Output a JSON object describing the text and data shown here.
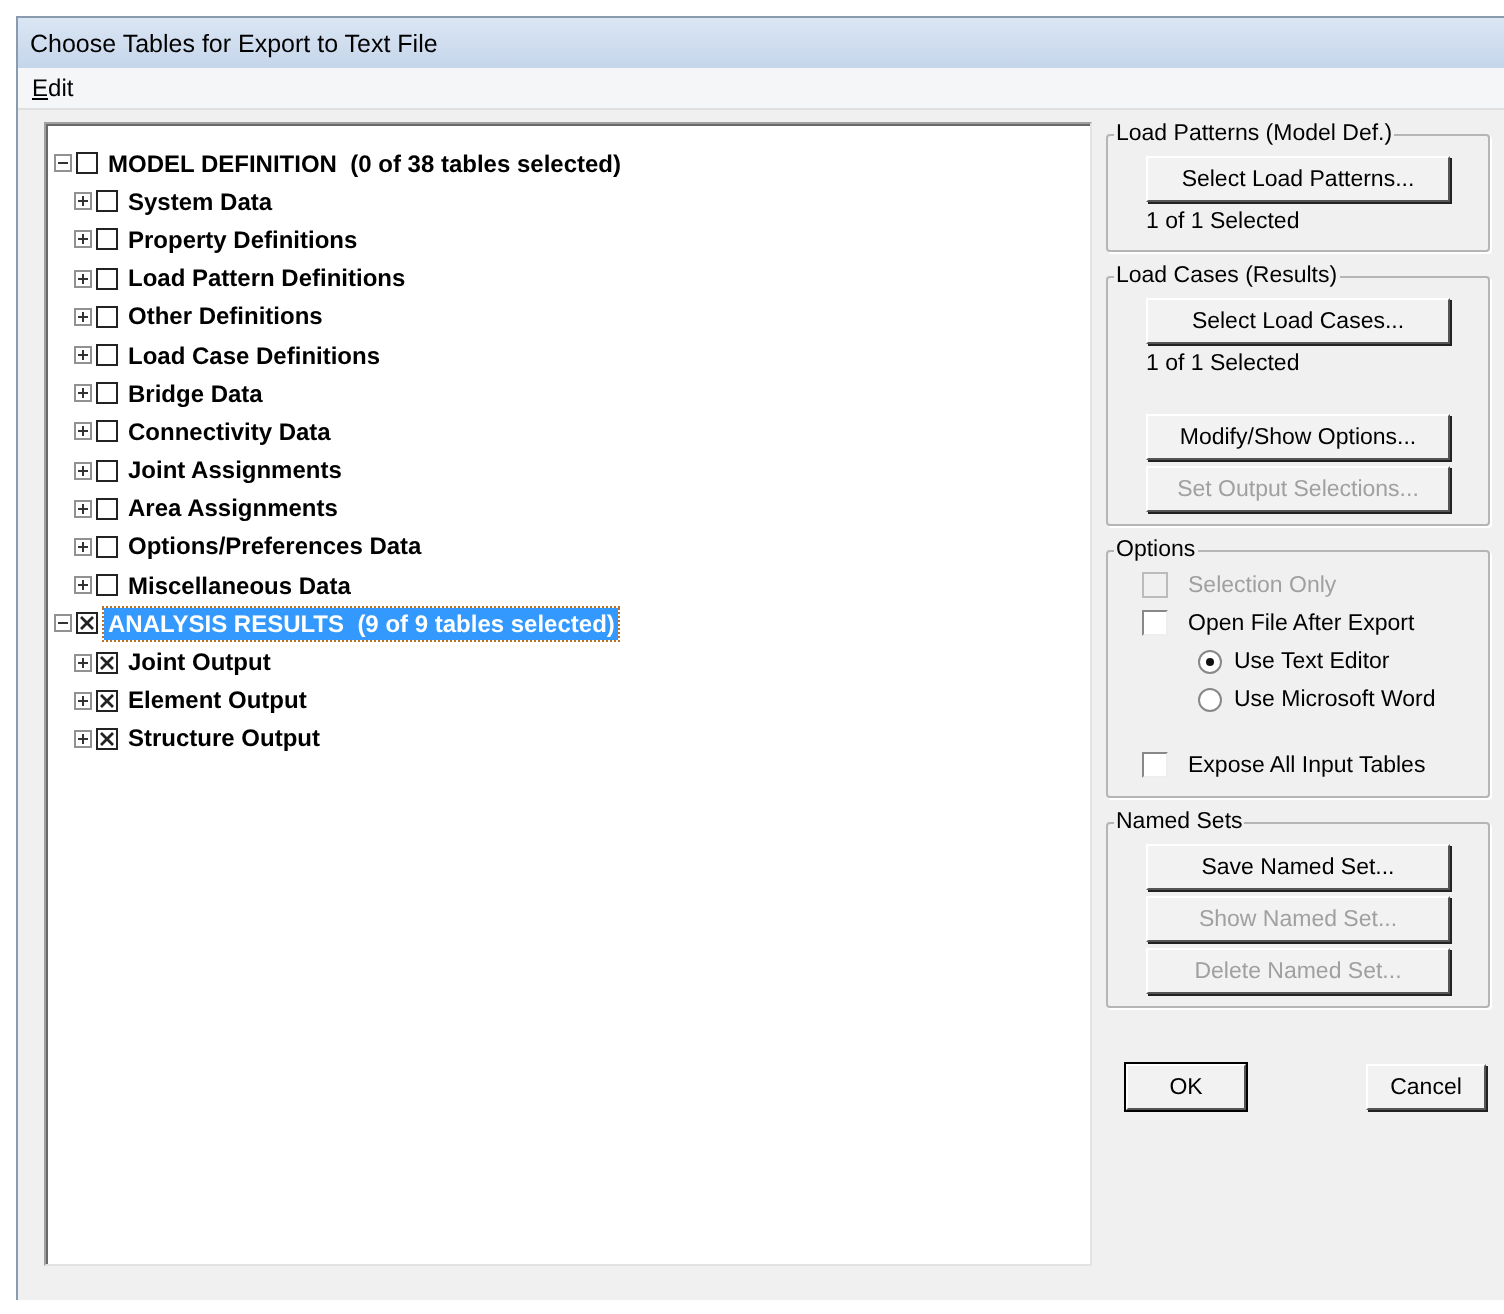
{
  "window": {
    "title": "Choose Tables for Export to Text File"
  },
  "menu": [
    {
      "label": "Edit"
    }
  ],
  "tree": [
    {
      "label": "MODEL DEFINITION  (0 of 38 tables selected)",
      "expanded": true,
      "checked": false,
      "selected": false,
      "children": [
        {
          "label": "System Data",
          "checked": false,
          "expanded": false
        },
        {
          "label": "Property Definitions",
          "checked": false,
          "expanded": false
        },
        {
          "label": "Load Pattern Definitions",
          "checked": false,
          "expanded": false
        },
        {
          "label": "Other Definitions",
          "checked": false,
          "expanded": false
        },
        {
          "label": "Load Case Definitions",
          "checked": false,
          "expanded": false
        },
        {
          "label": "Bridge Data",
          "checked": false,
          "expanded": false
        },
        {
          "label": "Connectivity Data",
          "checked": false,
          "expanded": false
        },
        {
          "label": "Joint Assignments",
          "checked": false,
          "expanded": false
        },
        {
          "label": "Area Assignments",
          "checked": false,
          "expanded": false
        },
        {
          "label": "Options/Preferences Data",
          "checked": false,
          "expanded": false
        },
        {
          "label": "Miscellaneous Data",
          "checked": false,
          "expanded": false
        }
      ]
    },
    {
      "label": "ANALYSIS RESULTS  (9 of 9 tables selected)",
      "expanded": true,
      "checked": true,
      "selected": true,
      "children": [
        {
          "label": "Joint Output",
          "checked": true,
          "expanded": false
        },
        {
          "label": "Element Output",
          "checked": true,
          "expanded": false
        },
        {
          "label": "Structure Output",
          "checked": true,
          "expanded": false
        }
      ]
    }
  ],
  "groups": [
    {
      "title": "Load Patterns (Model Def.)",
      "items": [
        {
          "kind": "button",
          "label": "Select Load Patterns...",
          "disabled": false
        },
        {
          "kind": "text",
          "label": "1 of 1 Selected"
        }
      ]
    },
    {
      "title": "Load Cases (Results)",
      "items": [
        {
          "kind": "button",
          "label": "Select Load Cases...",
          "disabled": false
        },
        {
          "kind": "text",
          "label": "1 of 1 Selected"
        },
        {
          "kind": "spacer"
        },
        {
          "kind": "button",
          "label": "Modify/Show Options...",
          "disabled": false
        },
        {
          "kind": "button",
          "label": "Set Output Selections...",
          "disabled": true
        }
      ]
    },
    {
      "title": "Options",
      "items": [
        {
          "kind": "checkbox",
          "label": "Selection Only",
          "checked": false,
          "disabled": true
        },
        {
          "kind": "checkbox",
          "label": "Open File After Export",
          "checked": false,
          "disabled": false
        },
        {
          "kind": "radio",
          "label": "Use Text Editor",
          "selected": true,
          "disabled": false
        },
        {
          "kind": "radio",
          "label": "Use Microsoft Word",
          "selected": false,
          "disabled": false
        },
        {
          "kind": "spacer"
        },
        {
          "kind": "checkbox",
          "label": "Expose All Input Tables",
          "checked": false,
          "disabled": false
        }
      ]
    },
    {
      "title": "Named Sets",
      "items": [
        {
          "kind": "button",
          "label": "Save Named Set...",
          "disabled": false
        },
        {
          "kind": "button",
          "label": "Show Named Set...",
          "disabled": true
        },
        {
          "kind": "button",
          "label": "Delete Named Set...",
          "disabled": true
        }
      ]
    }
  ],
  "buttons": [
    {
      "label": "OK",
      "default": true
    },
    {
      "label": "Cancel",
      "default": false
    }
  ]
}
